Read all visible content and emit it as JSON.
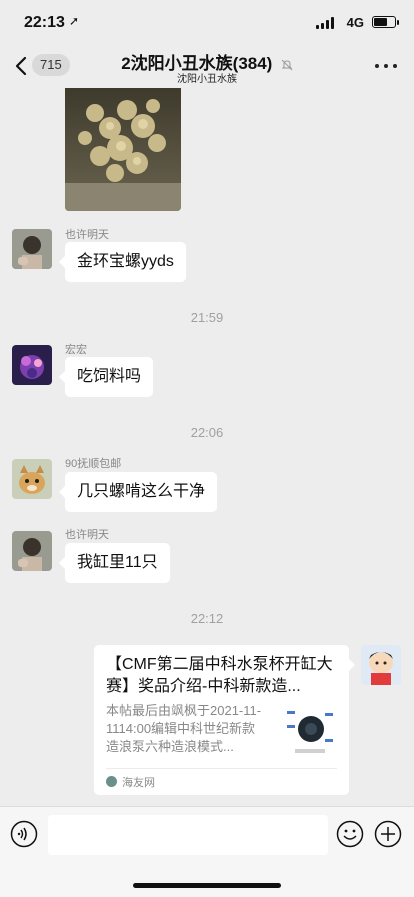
{
  "status": {
    "time": "22:13",
    "network": "4G",
    "battery_level": 0.7
  },
  "header": {
    "back_count": "715",
    "title": "2沈阳小丑水族(384)",
    "subtitle": "沈阳小丑水族"
  },
  "messages": [
    {
      "sender": "也许明天",
      "text": "金环宝螺yyds"
    },
    {
      "sender": "宏宏",
      "text": "吃饲料吗"
    },
    {
      "sender": "90抚顺包邮",
      "text": "几只螺啃这么干净"
    },
    {
      "sender": "也许明天",
      "text": "我缸里11只"
    }
  ],
  "timestamps": [
    "21:59",
    "22:06",
    "22:12"
  ],
  "link_card": {
    "title": "【CMF第二届中科水泵杯开缸大赛】奖品介绍-中科新款造...",
    "description": "本帖最后由飒枫于2021-11-1114:00编辑中科世纪新款造浪泵六种造浪模式...",
    "source": "海友网"
  },
  "colors": {
    "background": "#ededed",
    "bubble": "#ffffff",
    "input_bar": "#f6f6f6",
    "timestamp": "#a0a0a0"
  }
}
